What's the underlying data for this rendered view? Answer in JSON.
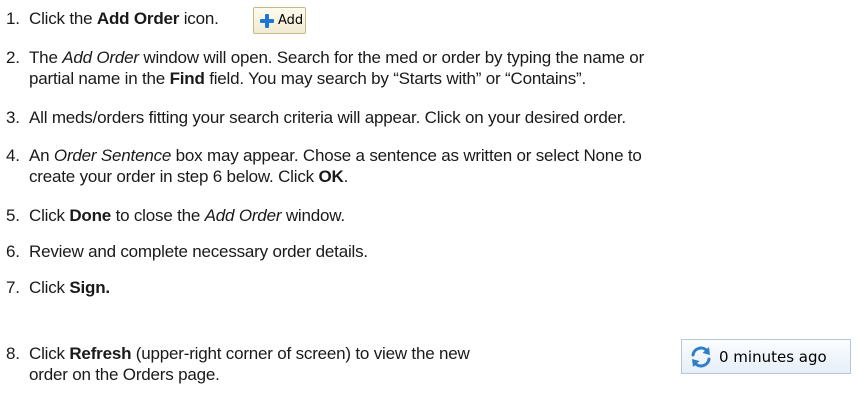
{
  "steps": [
    {
      "num": "1.",
      "pre": "Click the ",
      "bold": "Add Order",
      "post": " icon."
    },
    {
      "num": "2.",
      "pre": "The ",
      "italic": "Add Order",
      "mid": " window will open. Search for the med or order by typing the name or",
      "line2_pre": "partial name in the ",
      "line2_bold": "Find",
      "line2_post": " field.  You may search by “Starts with” or “Contains”."
    },
    {
      "num": "3.",
      "text": "All meds/orders fitting your search criteria will appear.  Click on your desired order."
    },
    {
      "num": "4.",
      "pre": "An ",
      "italic": "Order Sentence",
      "mid": " box may appear.  Chose a sentence as written or select None to",
      "line2_pre": "create your order in step 6 below. Click ",
      "line2_bold": "OK",
      "line2_post": "."
    },
    {
      "num": "5.",
      "pre": "Click ",
      "bold": "Done",
      "mid": " to close the ",
      "italic": "Add Order",
      "post": " window."
    },
    {
      "num": "6.",
      "text": "Review and complete necessary order details."
    },
    {
      "num": "7.",
      "pre": "Click ",
      "bold": "Sign."
    },
    {
      "num": "8.",
      "pre": "Click ",
      "bold": "Refresh",
      "mid": " (upper-right corner of screen) to view the new",
      "line2_text": "order on the Orders page."
    }
  ],
  "add_button": {
    "label": "Add",
    "icon": "plus-icon",
    "icon_color": "#1b78d6"
  },
  "refresh_widget": {
    "label": "0 minutes ago",
    "icon": "refresh-icon",
    "icon_color": "#2e7fc8"
  }
}
